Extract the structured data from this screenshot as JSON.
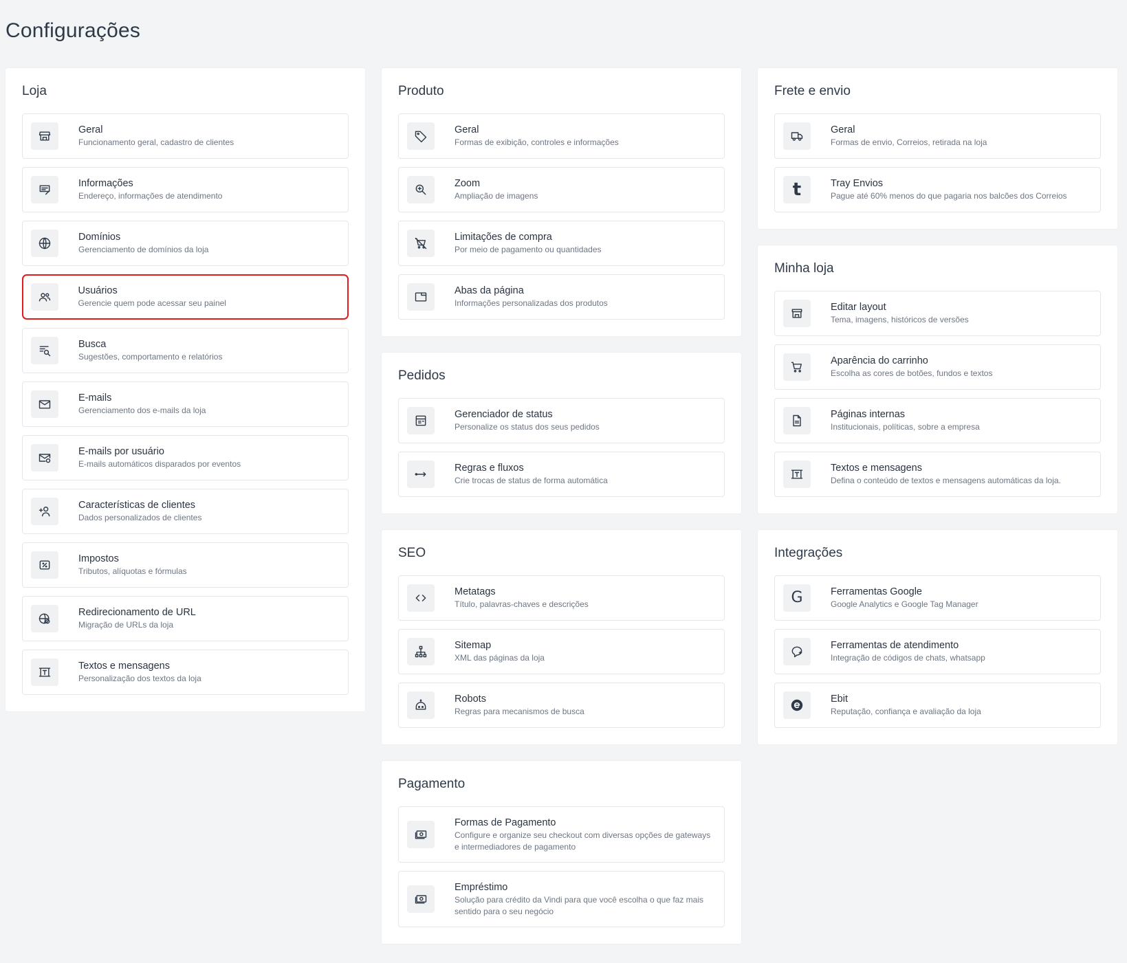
{
  "page_title": "Configurações",
  "loja": {
    "title": "Loja",
    "items": [
      {
        "title": "Geral",
        "desc": "Funcionamento geral, cadastro de clientes"
      },
      {
        "title": "Informações",
        "desc": "Endereço, informações de atendimento"
      },
      {
        "title": "Domínios",
        "desc": "Gerenciamento de domínios da loja"
      },
      {
        "title": "Usuários",
        "desc": "Gerencie quem pode acessar seu painel"
      },
      {
        "title": "Busca",
        "desc": "Sugestões, comportamento e relatórios"
      },
      {
        "title": "E-mails",
        "desc": "Gerenciamento dos e-mails da loja"
      },
      {
        "title": "E-mails por usuário",
        "desc": "E-mails automáticos disparados por eventos"
      },
      {
        "title": "Características de clientes",
        "desc": "Dados personalizados de clientes"
      },
      {
        "title": "Impostos",
        "desc": "Tributos, alíquotas e fórmulas"
      },
      {
        "title": "Redirecionamento de URL",
        "desc": "Migração de URLs da loja"
      },
      {
        "title": "Textos e mensagens",
        "desc": "Personalização dos textos da loja"
      }
    ]
  },
  "produto": {
    "title": "Produto",
    "items": [
      {
        "title": "Geral",
        "desc": "Formas de exibição, controles e informações"
      },
      {
        "title": "Zoom",
        "desc": "Ampliação de imagens"
      },
      {
        "title": "Limitações de compra",
        "desc": "Por meio de pagamento ou quantidades"
      },
      {
        "title": "Abas da página",
        "desc": "Informações personalizadas dos produtos"
      }
    ]
  },
  "pedidos": {
    "title": "Pedidos",
    "items": [
      {
        "title": "Gerenciador de status",
        "desc": "Personalize os status dos seus pedidos"
      },
      {
        "title": "Regras e fluxos",
        "desc": "Crie trocas de status de forma automática"
      }
    ]
  },
  "seo": {
    "title": "SEO",
    "items": [
      {
        "title": "Metatags",
        "desc": "Título, palavras-chaves e descrições"
      },
      {
        "title": "Sitemap",
        "desc": "XML das páginas da loja"
      },
      {
        "title": "Robots",
        "desc": "Regras para mecanismos de busca"
      }
    ]
  },
  "pagamento": {
    "title": "Pagamento",
    "items": [
      {
        "title": "Formas de Pagamento",
        "desc": "Configure e organize seu checkout com diversas opções de gateways e intermediadores de pagamento"
      },
      {
        "title": "Empréstimo",
        "desc": "Solução para crédito da Vindi para que você escolha o que faz mais sentido para o seu negócio"
      }
    ]
  },
  "frete": {
    "title": "Frete e envio",
    "items": [
      {
        "title": "Geral",
        "desc": "Formas de envio, Correios, retirada na loja"
      },
      {
        "title": "Tray Envios",
        "desc": "Pague até 60% menos do que pagaria nos balcões dos Correios",
        "glyph": "t"
      }
    ]
  },
  "minha_loja": {
    "title": "Minha loja",
    "items": [
      {
        "title": "Editar layout",
        "desc": "Tema, imagens, históricos de versões"
      },
      {
        "title": "Aparência do carrinho",
        "desc": "Escolha as cores de botões, fundos e textos"
      },
      {
        "title": "Páginas internas",
        "desc": "Institucionais, políticas, sobre a empresa"
      },
      {
        "title": "Textos e mensagens",
        "desc": "Defina o conteúdo de textos e mensagens automáticas da loja."
      }
    ]
  },
  "integracoes": {
    "title": "Integrações",
    "items": [
      {
        "title": "Ferramentas Google",
        "desc": "Google Analytics e Google Tag Manager",
        "glyph": "G"
      },
      {
        "title": "Ferramentas de atendimento",
        "desc": "Integração de códigos de chats, whatsapp"
      },
      {
        "title": "Ebit",
        "desc": "Reputação, confiança e avaliação da loja"
      }
    ]
  },
  "colors": {
    "background": "#f3f4f6",
    "card": "#ffffff",
    "selected_border": "#e01b1b",
    "icon_bg": "#f0f1f3",
    "text": "#2a3340",
    "muted": "#6c7683"
  }
}
